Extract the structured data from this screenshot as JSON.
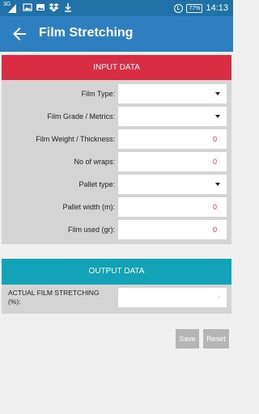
{
  "status_bar": {
    "signal_label": "3G",
    "battery": "77%",
    "time": "14:13",
    "icons": [
      "signal-icon",
      "image-icon",
      "dropbox-icon",
      "download-icon",
      "alarm-icon",
      "battery-icon"
    ]
  },
  "app_bar": {
    "title": "Film Stretching",
    "back_icon": "arrow-left-icon"
  },
  "input_card": {
    "header": "INPUT DATA",
    "fields": [
      {
        "label": "Film Type:",
        "type": "select",
        "value": ""
      },
      {
        "label": "Film Grade / Metrics:",
        "type": "select",
        "value": ""
      },
      {
        "label": "Film Weight / Thickness:",
        "type": "number",
        "value": "0"
      },
      {
        "label": "No of wraps:",
        "type": "number",
        "value": "0"
      },
      {
        "label": "Pallet type:",
        "type": "select",
        "value": ""
      },
      {
        "label": "Pallet width (m):",
        "type": "number",
        "value": "0"
      },
      {
        "label": "Film used (gr):",
        "type": "number",
        "value": "0"
      }
    ]
  },
  "output_card": {
    "header": "OUTPUT DATA",
    "label": "ACTUAL FILM STRETCHING (%):",
    "value": "-"
  },
  "buttons": {
    "save": "Save",
    "reset": "Reset"
  },
  "colors": {
    "status_bar": "#1f71a8",
    "app_bar": "#2d7fc0",
    "input_header": "#d92d44",
    "output_header": "#12a3b8",
    "value_text": "#d92d44"
  }
}
